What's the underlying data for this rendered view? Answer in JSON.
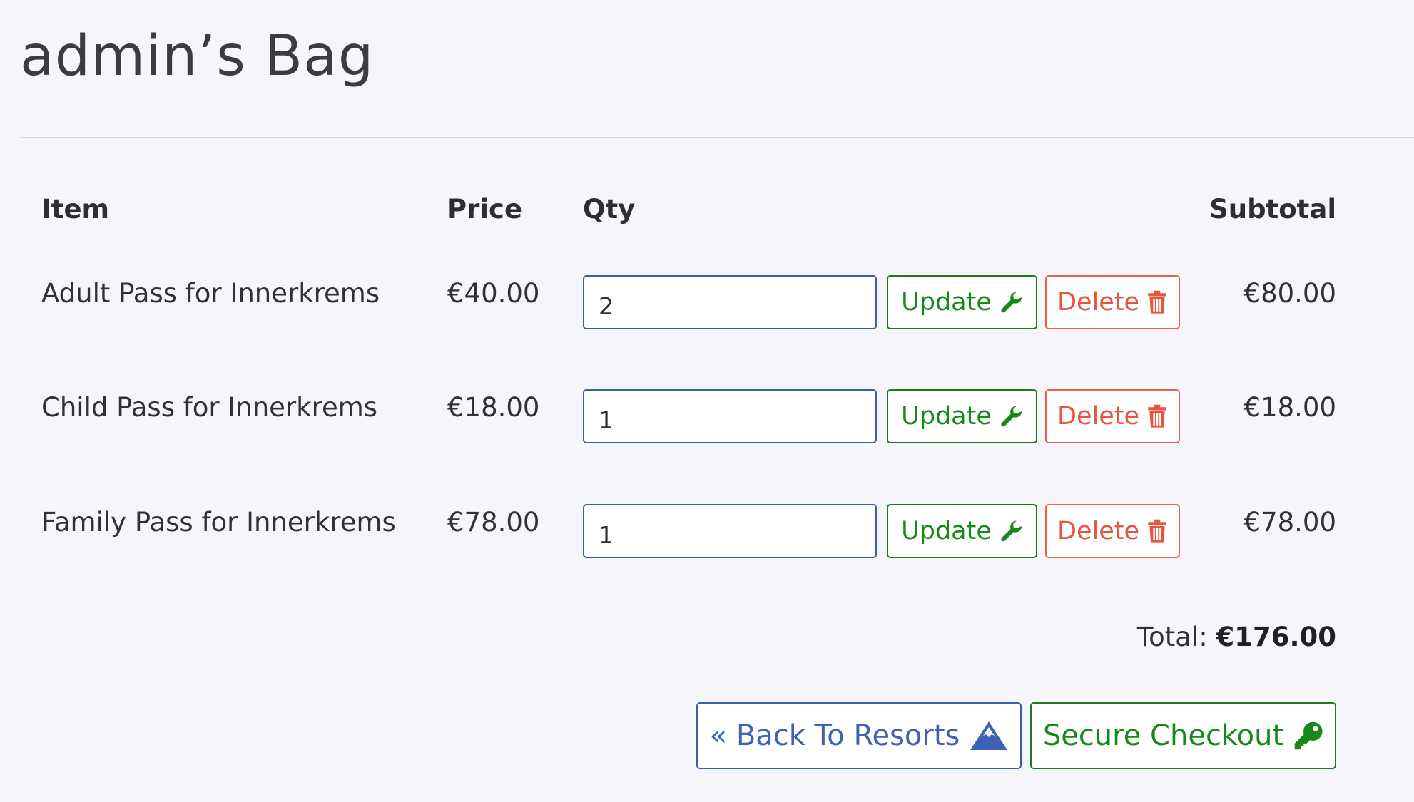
{
  "page_title": "admin’s Bag",
  "table": {
    "headers": {
      "item": "Item",
      "price": "Price",
      "qty": "Qty",
      "subtotal": "Subtotal"
    },
    "rows": [
      {
        "item": "Adult Pass for Innerkrems",
        "price": "€40.00",
        "qty": "2",
        "subtotal": "€80.00"
      },
      {
        "item": "Child Pass for Innerkrems",
        "price": "€18.00",
        "qty": "1",
        "subtotal": "€18.00"
      },
      {
        "item": "Family Pass for Innerkrems",
        "price": "€78.00",
        "qty": "1",
        "subtotal": "€78.00"
      }
    ]
  },
  "buttons": {
    "update_label": "Update",
    "delete_label": "Delete",
    "back_label": "« Back To Resorts",
    "checkout_label": "Secure Checkout"
  },
  "total": {
    "label": "Total:",
    "value": "€176.00"
  },
  "icons": {
    "update": "wrench-icon",
    "delete": "trash-icon",
    "back": "mountain-icon",
    "checkout": "key-icon"
  },
  "colors": {
    "background": "#f6f6fa",
    "green": "#168a18",
    "red": "#e7553f",
    "blue": "#3e63b4"
  }
}
